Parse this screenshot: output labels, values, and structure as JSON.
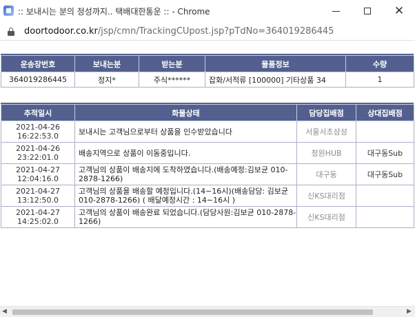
{
  "window": {
    "title": ":: 보내시는 분의 정성까지.. 택배대한통운 :: - Chrome",
    "url_domain": "doortodoor.co.kr",
    "url_path": "/jsp/cmn/TrackingCUpost.jsp?pTdNo=364019286445"
  },
  "shipment": {
    "headers": [
      "운송장번호",
      "보내는분",
      "받는분",
      "물품정보",
      "수량"
    ],
    "row": {
      "tracking_no": "364019286445",
      "sender": "정지*",
      "receiver": "주식******",
      "goods": "잡화/서적류 [100000] 기타상품 34",
      "quantity": "1"
    }
  },
  "tracking": {
    "headers": [
      "추적일시",
      "화물상태",
      "담당집배점",
      "상대집배점"
    ],
    "rows": [
      {
        "date": "2021-04-26",
        "time": "16:22:53.0",
        "status": "보내시는 고객님으로부터 상품을 인수받았습니다",
        "branch": "서울서초삼성",
        "counterpart": ""
      },
      {
        "date": "2021-04-26",
        "time": "23:22:01.0",
        "status": "배송지역으로 상품이 이동중입니다.",
        "branch": "청원HUB",
        "counterpart": "대구동Sub"
      },
      {
        "date": "2021-04-27",
        "time": "12:04:16.0",
        "status": "고객님의 상품이 배송지에 도착하였습니다.(배송예정:김보균 010-2878-1266)",
        "branch": "대구동",
        "counterpart": "대구동Sub"
      },
      {
        "date": "2021-04-27",
        "time": "13:12:50.0",
        "status": "고객님의 상품을 배송할 예정입니다.(14∼16시)(배송담당: 김보균 010-2878-1266) ( 배달예정시간 : 14∼16시 )",
        "branch": "신KS대리점",
        "counterpart": ""
      },
      {
        "date": "2021-04-27",
        "time": "14:25:02.0",
        "status": "고객님의 상품이 배송완료 되었습니다.(담당사원:김보균 010-2878-1266)",
        "branch": "신KS대리점",
        "counterpart": ""
      }
    ]
  }
}
